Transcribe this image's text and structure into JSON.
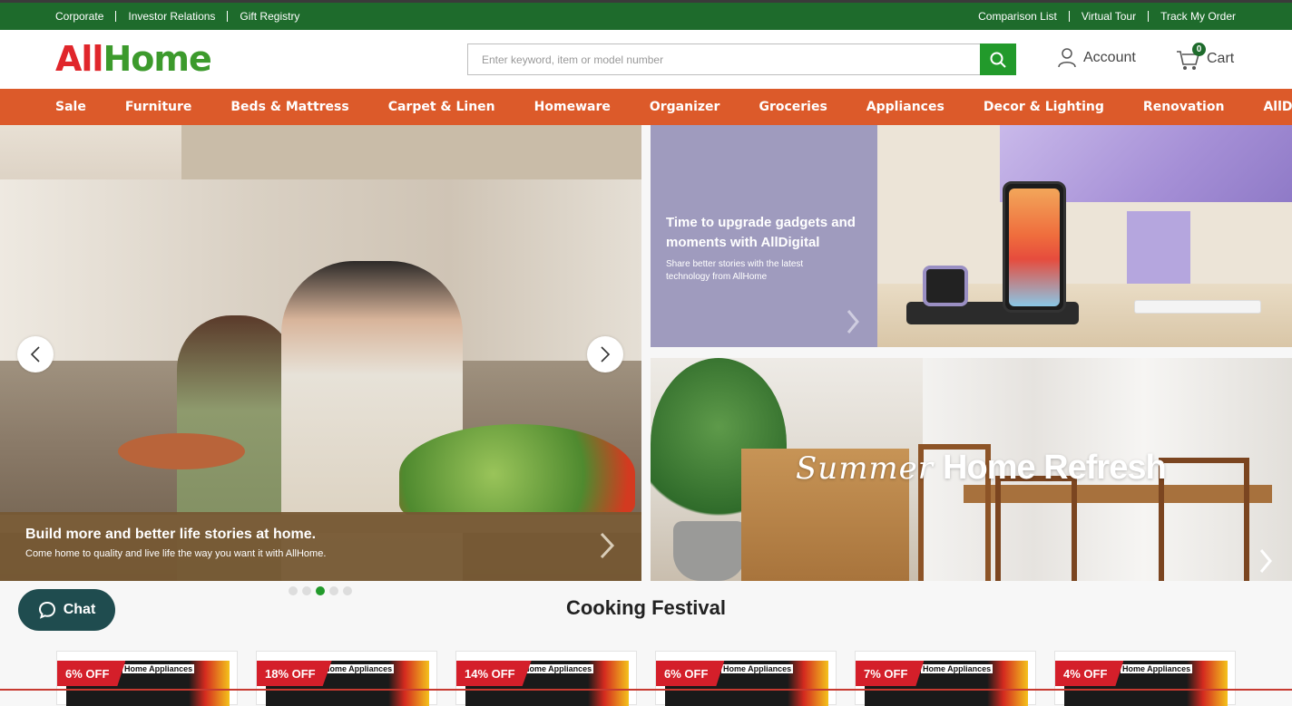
{
  "topbar": {
    "left_links": [
      "Corporate",
      "Investor Relations",
      "Gift Registry"
    ],
    "right_links": [
      "Comparison List",
      "Virtual Tour",
      "Track My Order"
    ]
  },
  "header": {
    "logo_part1": "All",
    "logo_part2": "Home",
    "search_placeholder": "Enter keyword, item or model number",
    "account_label": "Account",
    "cart_label": "Cart",
    "cart_count": "0"
  },
  "nav": {
    "items": [
      "Sale",
      "Furniture",
      "Beds & Mattress",
      "Carpet & Linen",
      "Homeware",
      "Organizer",
      "Groceries",
      "Appliances",
      "Decor & Lighting",
      "Renovation",
      "AllDigital"
    ]
  },
  "hero": {
    "title": "Build more and better life stories at home.",
    "subtitle": "Come home to quality and live life the way you want it with AllHome.",
    "slide_count": 5,
    "active_slide": 3
  },
  "banner_digital": {
    "title": "Time to upgrade gadgets and moments with AllDigital",
    "subtitle": "Share better stories with the latest technology from AllHome"
  },
  "banner_refresh": {
    "title_script": "Summer",
    "title_main": "Home Refresh"
  },
  "chat": {
    "label": "Chat"
  },
  "section": {
    "title": "Cooking Festival",
    "products": [
      {
        "discount": "6% OFF",
        "category": "Home Appliances"
      },
      {
        "discount": "18% OFF",
        "category": "Home Appliances"
      },
      {
        "discount": "14% OFF",
        "category": "Home Appliances"
      },
      {
        "discount": "6% OFF",
        "category": "Home Appliances"
      },
      {
        "discount": "7% OFF",
        "category": "Home Appliances"
      },
      {
        "discount": "4% OFF",
        "category": "Home Appliances"
      }
    ]
  },
  "colors": {
    "topbar": "#1e6b2c",
    "nav": "#dc5a2a",
    "accent_green": "#229a2b",
    "logo_red": "#e0262b",
    "logo_green": "#3c9a2c",
    "discount_red": "#d41f2a",
    "chat": "#1f4c4f"
  }
}
